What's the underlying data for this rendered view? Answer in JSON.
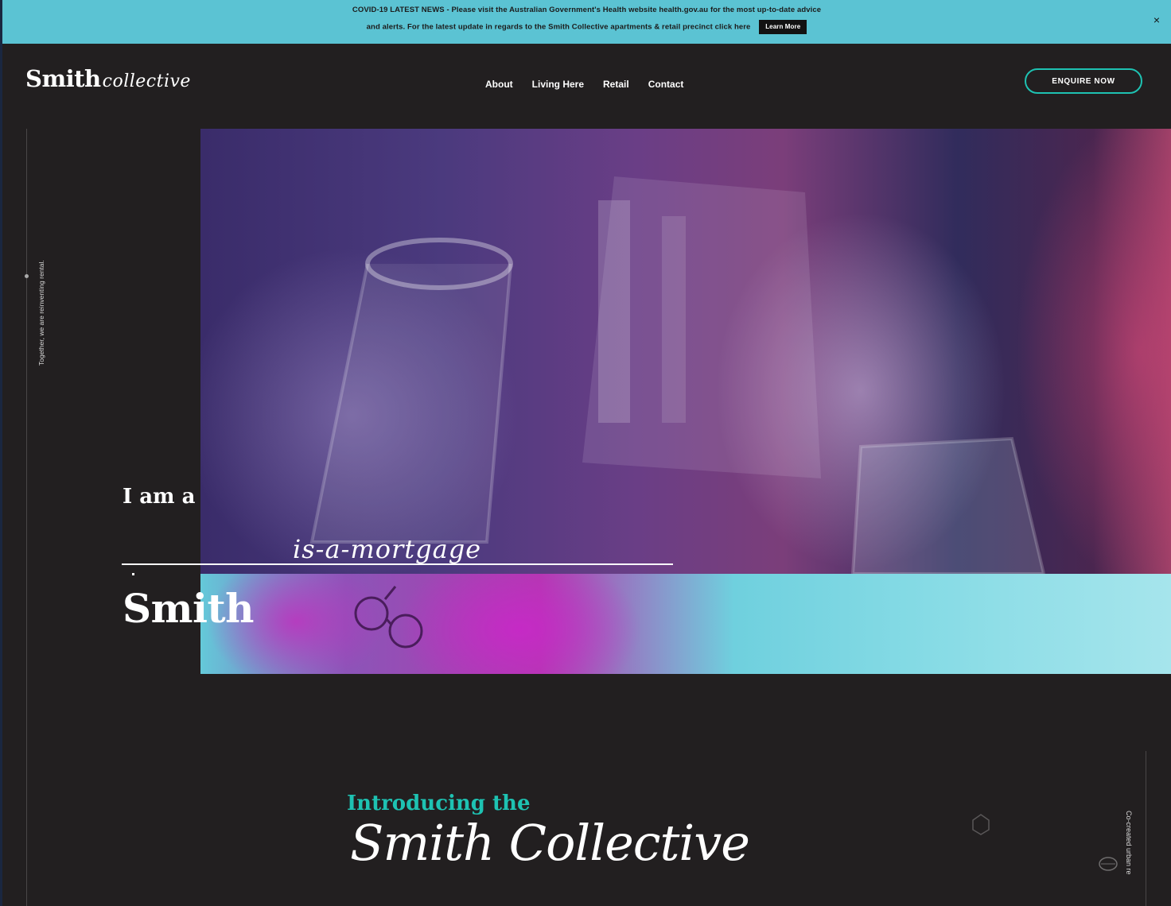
{
  "banner": {
    "line1": "COVID-19 LATEST NEWS - Please visit the Australian Government's Health website health.gov.au for the most up-to-date advice",
    "line2": "and alerts. For the latest update in regards to the Smith Collective apartments & retail precinct click here",
    "learn_more": "Learn More",
    "close": "×"
  },
  "header": {
    "logo_main": "Smith",
    "logo_script": "collective",
    "nav": [
      "About",
      "Living Here",
      "Retail",
      "Contact"
    ],
    "cta": "ENQUIRE NOW"
  },
  "side": {
    "left_tagline": "Together, we are reinventing rental.",
    "right_tagline": "Co-created urban re"
  },
  "hero": {
    "prefix": "I am a",
    "rotating_word": "is-a-mortgage",
    "name": "Smith"
  },
  "intro": {
    "label": "Introducing the",
    "script": "Smith Collective"
  },
  "colors": {
    "banner": "#5bc3d3",
    "background": "#221f20",
    "accent": "#1ec2b2"
  }
}
